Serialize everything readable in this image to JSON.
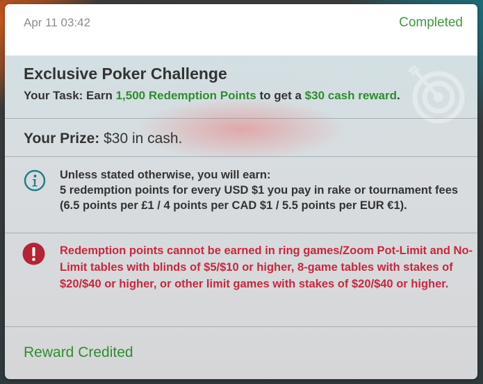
{
  "card": {
    "date": "Apr 11 03:42",
    "status": "Completed",
    "title": "Exclusive Poker Challenge",
    "task": {
      "prefix": "Your Task: Earn ",
      "points": "1,500 Redemption Points",
      "middle": " to get a ",
      "reward": "$30 cash reward",
      "suffix": "."
    },
    "prize": {
      "label": "Your Prize:",
      "value": " $30 in cash."
    },
    "info": {
      "icon": "info-icon",
      "line1": "Unless stated otherwise, you will earn:",
      "line2": "5 redemption points for every USD $1 you pay in rake or tournament fees (6.5 points per £1 / 4 points per CAD $1 / 5.5 points per EUR €1)."
    },
    "warning": {
      "icon": "exclamation-icon",
      "text": "Redemption points cannot be earned in ring games/Zoom Pot-Limit and No-Limit tables with blinds of $5/$10 or higher, 8-game tables with stakes of $20/$40 or higher, or other limit games with stakes of $20/$40 or higher."
    },
    "footer": "Reward Credited"
  },
  "colors": {
    "green": "#2f8c2f",
    "status_green": "#3c9a39",
    "warning_red": "#c8283d",
    "info_teal": "#1f7f8a"
  }
}
